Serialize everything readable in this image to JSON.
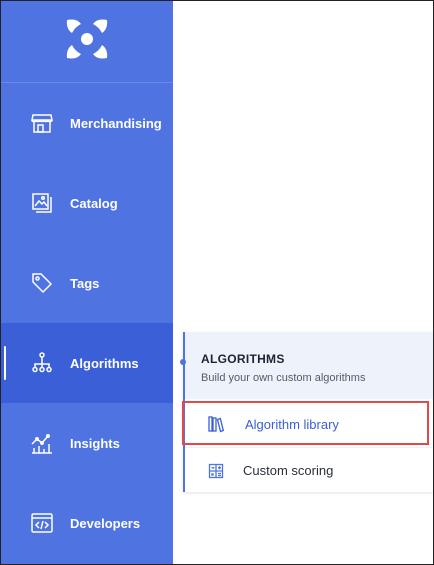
{
  "sidebar": {
    "logo_icon": "app-logo-icon",
    "items": [
      {
        "label": "Merchandising",
        "icon": "storefront-icon"
      },
      {
        "label": "Catalog",
        "icon": "image-stack-icon"
      },
      {
        "label": "Tags",
        "icon": "tag-icon"
      },
      {
        "label": "Algorithms",
        "icon": "hierarchy-icon",
        "active": true
      },
      {
        "label": "Insights",
        "icon": "analytics-chart-icon"
      },
      {
        "label": "Developers",
        "icon": "code-window-icon"
      }
    ]
  },
  "flyout": {
    "title": "ALGORITHMS",
    "subtitle": "Build your own custom algorithms",
    "items": [
      {
        "label": "Algorithm library",
        "icon": "books-icon",
        "highlighted": true
      },
      {
        "label": "Custom scoring",
        "icon": "grid-calculator-icon"
      }
    ]
  },
  "colors": {
    "sidebar_bg": "#4f74e2",
    "sidebar_active_bg": "#3a5fd6",
    "accent": "#3a5fd6",
    "highlight_border": "#e04a4a"
  }
}
